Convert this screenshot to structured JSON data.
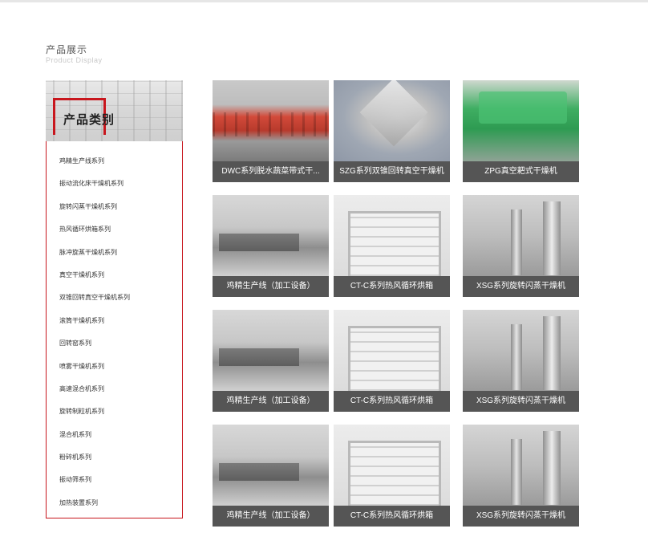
{
  "section": {
    "title": "产品展示",
    "subtitle": "Product Display"
  },
  "sidebar": {
    "header": "产品类别",
    "items": [
      {
        "label": "鸡精生产线系列"
      },
      {
        "label": "振动流化床干燥机系列"
      },
      {
        "label": "旋转闪蒸干燥机系列"
      },
      {
        "label": "热风循环烘箱系列"
      },
      {
        "label": "脉冲旋蒸干燥机系列"
      },
      {
        "label": "真空干燥机系列"
      },
      {
        "label": "双锥回转真空干燥机系列"
      },
      {
        "label": "滚筒干燥机系列"
      },
      {
        "label": "回转窑系列"
      },
      {
        "label": "喷雾干燥机系列"
      },
      {
        "label": "高速混合机系列"
      },
      {
        "label": "旋转制粒机系列"
      },
      {
        "label": "混合机系列"
      },
      {
        "label": "粉碎机系列"
      },
      {
        "label": "振动筛系列"
      },
      {
        "label": "加热装置系列"
      }
    ]
  },
  "products": [
    {
      "caption": "DWC系列脱水蔬菜带式干...",
      "image": "belt-dryer-photo"
    },
    {
      "caption": "SZG系列双锥回转真空干燥机",
      "image": "double-cone-dryer-photo"
    },
    {
      "caption": "ZPG真空耙式干燥机",
      "image": "rake-dryer-photo"
    },
    {
      "caption": "鸡精生产线（加工设备）",
      "image": "production-line-photo"
    },
    {
      "caption": "CT-C系列热风循环烘箱",
      "image": "oven-photo"
    },
    {
      "caption": "XSG系列旋转闪蒸干燥机",
      "image": "flash-dryer-photo"
    },
    {
      "caption": "鸡精生产线（加工设备）",
      "image": "production-line-photo"
    },
    {
      "caption": "CT-C系列热风循环烘箱",
      "image": "oven-photo"
    },
    {
      "caption": "XSG系列旋转闪蒸干燥机",
      "image": "flash-dryer-photo"
    },
    {
      "caption": "鸡精生产线（加工设备）",
      "image": "production-line-photo"
    },
    {
      "caption": "CT-C系列热风循环烘箱",
      "image": "oven-photo"
    },
    {
      "caption": "XSG系列旋转闪蒸干燥机",
      "image": "flash-dryer-photo"
    }
  ],
  "colors": {
    "accent": "#c8161d",
    "caption_bg": "#555555"
  }
}
